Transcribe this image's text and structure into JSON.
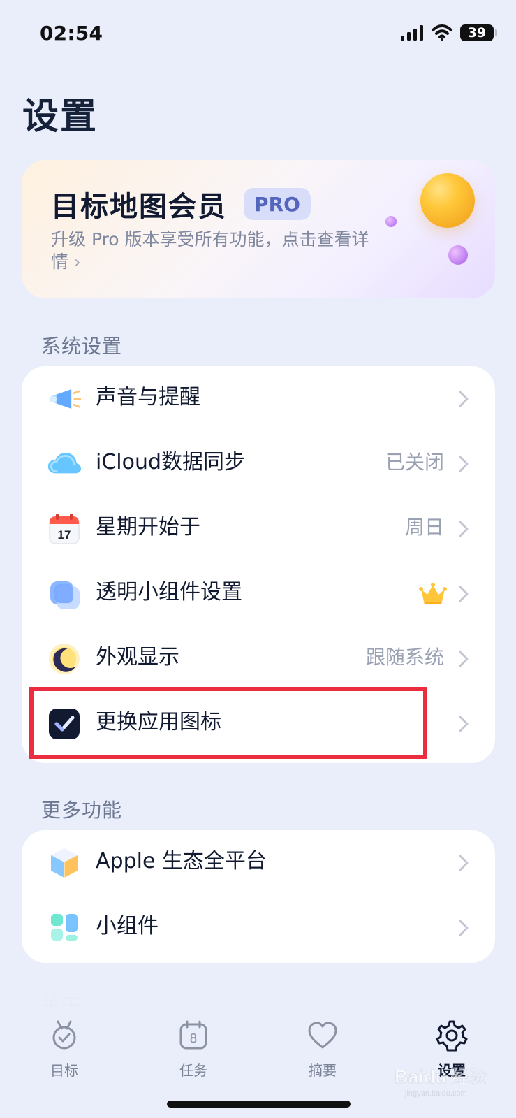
{
  "status_bar": {
    "time": "02:54",
    "battery": "39"
  },
  "page": {
    "title": "设置"
  },
  "pro": {
    "title": "目标地图会员",
    "badge": "PRO",
    "subtitle": "升级 Pro 版本享受所有功能，点击查看详情"
  },
  "sections": {
    "system": {
      "title": "系统设置",
      "items": [
        {
          "label": "声音与提醒",
          "value": "",
          "icon": "megaphone-icon"
        },
        {
          "label": "iCloud数据同步",
          "value": "已关闭",
          "icon": "cloud-icon"
        },
        {
          "label": "星期开始于",
          "value": "周日",
          "icon": "calendar-icon",
          "icon_text": "17"
        },
        {
          "label": "透明小组件设置",
          "value": "",
          "icon": "widget-icon",
          "badge_icon": "crown-icon"
        },
        {
          "label": "外观显示",
          "value": "跟随系统",
          "icon": "moon-icon"
        },
        {
          "label": "更换应用图标",
          "value": "",
          "icon": "app-icon"
        }
      ]
    },
    "more": {
      "title": "更多功能",
      "items": [
        {
          "label": "Apple 生态全平台",
          "value": "",
          "icon": "cube-icon"
        },
        {
          "label": "小组件",
          "value": "",
          "icon": "widgets-grid-icon"
        }
      ]
    },
    "about": {
      "title": "关于"
    }
  },
  "tab_bar": {
    "items": [
      {
        "label": "目标",
        "icon": "medal-icon"
      },
      {
        "label": "任务",
        "icon": "task-calendar-icon",
        "icon_text": "8"
      },
      {
        "label": "摘要",
        "icon": "heart-icon"
      },
      {
        "label": "设置",
        "icon": "gear-icon",
        "active": true
      }
    ]
  },
  "watermark": {
    "brand": "Baidu",
    "suffix": "经验",
    "url": "jingyan.baidu.com"
  },
  "colors": {
    "background": "#eaeefa",
    "text_primary": "#16223a",
    "text_secondary": "#9aa1b3",
    "highlight": "#ec2d40",
    "pro_badge_bg": "#d8def9",
    "pro_badge_text": "#5465bd"
  }
}
